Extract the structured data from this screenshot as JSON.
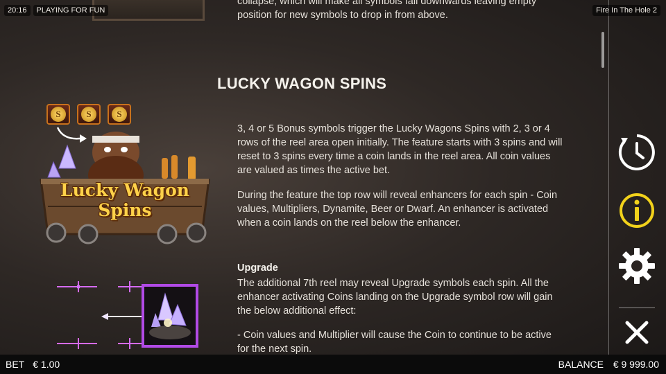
{
  "topbar": {
    "time": "20:16",
    "mode": "PLAYING FOR FUN",
    "game_name": "Fire In The Hole 2"
  },
  "intro_text": "collapse, which will make all symbols fall downwards leaving empty position for new symbols to drop in from above.",
  "section": {
    "title": "LUCKY WAGON SPINS",
    "paragraph1": "3, 4 or 5 Bonus symbols trigger the Lucky Wagons Spins with 2, 3 or 4 rows of the reel area open initially. The feature starts with 3 spins and will reset to 3 spins every time a coin lands in the reel area. All coin values are valued as times the active bet.",
    "paragraph2": "During the feature the top row will reveal enhancers for each spin - Coin values, Multipliers, Dynamite, Beer or Dwarf. An enhancer is activated when a coin lands on the reel below the enhancer.",
    "upgrade_heading": "Upgrade",
    "paragraph3": "The additional 7th reel may reveal Upgrade symbols each spin. All the enhancer activating Coins landing on the Upgrade symbol row will gain the below additional effect:",
    "paragraph4": "- Coin values and Multiplier will cause the Coin to continue to be active for the next spin."
  },
  "artwork": {
    "wagon_line1": "Lucky Wagon",
    "wagon_line2": "Spins",
    "coin_letter": "S"
  },
  "side_buttons": {
    "clock_icon": "clock-icon",
    "info_icon": "info-icon",
    "gear_icon": "gear-icon",
    "close_icon": "close-icon",
    "info_color": "#f2d21b"
  },
  "bottombar": {
    "bet_label": "BET",
    "bet_value": "€ 1.00",
    "balance_label": "BALANCE",
    "balance_value": "€ 9 999.00"
  }
}
